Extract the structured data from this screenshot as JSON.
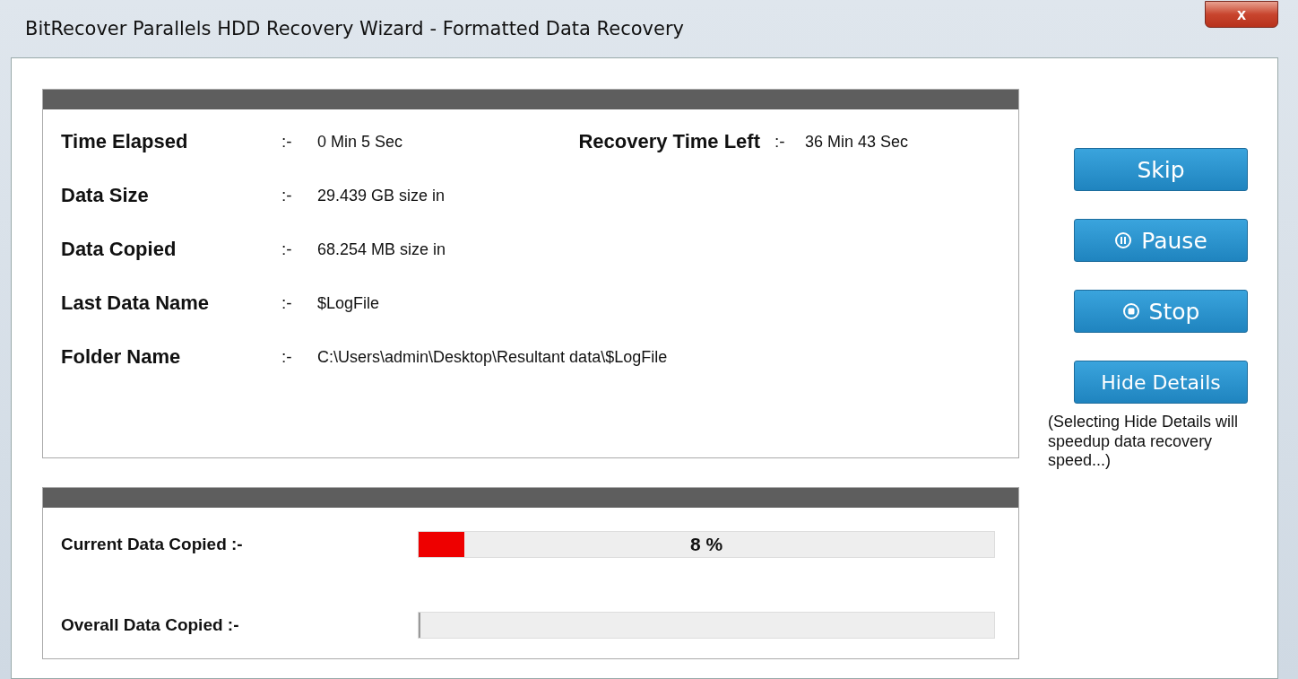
{
  "window": {
    "title": "BitRecover Parallels HDD Recovery Wizard - Formatted Data Recovery",
    "close": "x"
  },
  "details": [
    {
      "label": "Time Elapsed",
      "separator": ":-",
      "value": "0 Min 5 Sec",
      "extra": {
        "label": "Recovery Time Left",
        "separator": ":-",
        "value": "36 Min 43 Sec"
      }
    },
    {
      "label": "Data Size",
      "separator": ":-",
      "value": "29.439 GB size in"
    },
    {
      "label": "Data Copied",
      "separator": ":-",
      "value": "68.254 MB size in"
    },
    {
      "label": "Last Data Name",
      "separator": ":-",
      "value": "$LogFile"
    },
    {
      "label": "Folder Name",
      "separator": ":-",
      "value": "C:\\Users\\admin\\Desktop\\Resultant data\\$LogFile"
    }
  ],
  "progress": [
    {
      "label": "Current Data Copied :-",
      "level": 0.08,
      "reading": "8 %"
    },
    {
      "label": "Overall Data Copied :-",
      "level": 0
    }
  ],
  "buttons": [
    {
      "label": "Skip",
      "kind": "plain"
    },
    {
      "label": "Pause",
      "kind": "pause"
    },
    {
      "label": "Stop",
      "kind": "stop"
    },
    {
      "label": "Hide Details",
      "kind": "plain"
    }
  ],
  "note": "(Selecting Hide Details will speedup data recovery speed...)"
}
